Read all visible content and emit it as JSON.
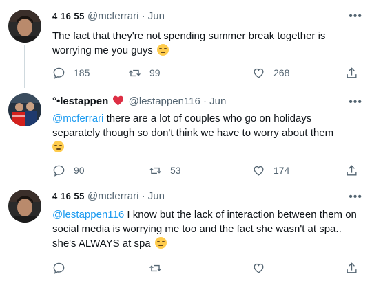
{
  "tweets": [
    {
      "display_name": "4 16 55",
      "handle": "@mcferrari",
      "date": "Jun",
      "text": "The fact that they're not spending summer break  together is worrying me you guys",
      "replies": "185",
      "retweets": "99",
      "likes": "268"
    },
    {
      "display_name": "°•lestappen",
      "handle": "@lestappen116",
      "date": "Jun",
      "mention": "@mcferrari",
      "text": " there are a lot of couples who go on holidays separately though so don't think we have to worry about them",
      "replies": "90",
      "retweets": "53",
      "likes": "174"
    },
    {
      "display_name": "4 16 55",
      "handle": "@mcferrari",
      "date": "Jun",
      "mention": "@lestappen116",
      "text": " I know but the lack of interaction between them on social media is worrying me too and the fact she wasn't at spa.. she's ALWAYS at spa"
    }
  ],
  "separator": "·",
  "more_glyph": "•••",
  "colors": {
    "link": "#1d9bf0",
    "muted": "#536471",
    "heart": "#f91880"
  },
  "icons": [
    "reply-icon",
    "retweet-icon",
    "like-icon",
    "share-icon",
    "heart-emoji-icon",
    "more-icon"
  ]
}
